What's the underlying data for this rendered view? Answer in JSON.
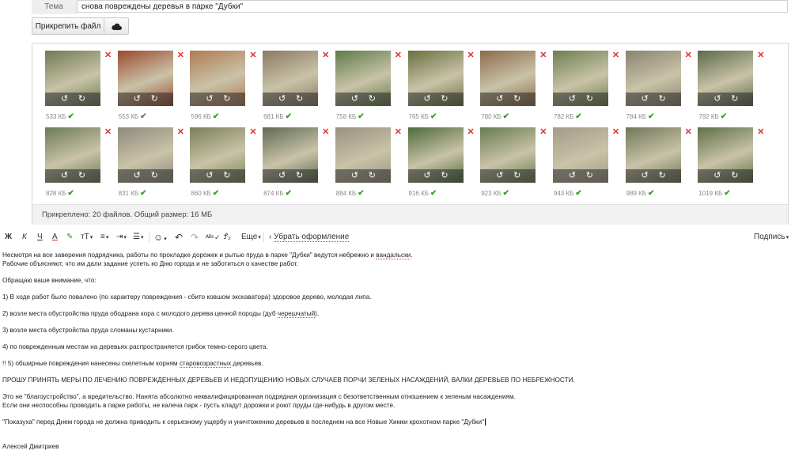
{
  "subject": {
    "label": "Тема",
    "value": "снова повреждены деревья в парке \"Дубки\""
  },
  "attach": {
    "button_label": "Прикрепить файл",
    "cloud_icon": "cloud-icon",
    "summary": "Прикреплено: 20 файлов. Общий размер: 16 МБ",
    "files": [
      {
        "size": "533 КБ",
        "tone": "#6f7a52"
      },
      {
        "size": "553 КБ",
        "tone": "#9a4a2e"
      },
      {
        "size": "596 КБ",
        "tone": "#b07a52"
      },
      {
        "size": "681 КБ",
        "tone": "#8a7a62"
      },
      {
        "size": "758 КБ",
        "tone": "#5f7a48"
      },
      {
        "size": "765 КБ",
        "tone": "#6a7040"
      },
      {
        "size": "780 КБ",
        "tone": "#8c6a4a"
      },
      {
        "size": "782 КБ",
        "tone": "#6d7f50"
      },
      {
        "size": "784 КБ",
        "tone": "#8a8270"
      },
      {
        "size": "792 КБ",
        "tone": "#5d6a4c"
      },
      {
        "size": "828 КБ",
        "tone": "#6c7a56"
      },
      {
        "size": "831 КБ",
        "tone": "#8f8a7c"
      },
      {
        "size": "860 КБ",
        "tone": "#7a8058"
      },
      {
        "size": "874 КБ",
        "tone": "#5f6a55"
      },
      {
        "size": "884 КБ",
        "tone": "#9a9080"
      },
      {
        "size": "916 КБ",
        "tone": "#4f6a3c"
      },
      {
        "size": "923 КБ",
        "tone": "#667a50"
      },
      {
        "size": "943 КБ",
        "tone": "#a49a88"
      },
      {
        "size": "989 КБ",
        "tone": "#6f7658"
      },
      {
        "size": "1019 КБ",
        "tone": "#5e7048"
      }
    ]
  },
  "toolbar": {
    "bold": "Ж",
    "italic": "К",
    "underline": "Ч",
    "text_color": "A",
    "highlight": "✎",
    "font_size": "тТ",
    "align": "≡",
    "indent": "⇥",
    "list": "☰",
    "emoji": "☺",
    "undo": "↶",
    "redo": "↷",
    "spellcheck": "ᴬᴮᶜ✓",
    "translit": "Ꝭ₂",
    "more": "Еще",
    "remove_format": "Убрать оформление",
    "signature": "Подпись"
  },
  "body": {
    "p1a": "Несмотря на все заверения подрядчика, работы по прокладке дорожек и рытью пруда в парке \"Дубки\" ведутся небрежно и ",
    "p1b": "вандальски",
    "p1c": ".",
    "p2": "Рабочие объясняют, что им дали задание успеть ко Дню города и не заботиться о качестве работ.",
    "p3": "Обращаю ваше внимание, что:",
    "p4": "1) В ходе работ было повалено (по характеру повреждения - сбито ковшом экскаватора) здоровое дерево, молодая липа.",
    "p5a": "2) возле места обустройства пруда ободрана кора с молодого дерева ценной породы (дуб ",
    "p5b": "черешчатый",
    "p5c": ").",
    "p6": "3) возле места обустройства пруда сломаны кустарники.",
    "p7": "4) по поврежденным местам на деревьях распространяется грибок темно-серого цвета.",
    "p8a": "!! 5) обширные повреждения нанесены скелетным корням ",
    "p8b": "старовозрастных",
    "p8c": " деревьев.",
    "p9": "ПРОШУ ПРИНЯТЬ МЕРЫ ПО ЛЕЧЕНИЮ ПОВРЕЖДЕННЫХ ДЕРЕВЬЕВ И НЕДОПУЩЕНИЮ НОВЫХ СЛУЧАЕВ ПОРЧИ ЗЕЛЕНЫХ НАСАЖДЕНИЙ, ВАЛКИ ДЕРЕВЬЕВ ПО НЕБРЕЖНОСТИ.",
    "p10": "Это не \"благоустройство\", а вредительство. Нанята абсолютно неквалифицированная подрядная организация с безответственным отношением к зеленым насаждениям.",
    "p11": "Если они неспособны проводить в парке работы, не калеча парк - пусть кладут дорожки и роют пруды где-нибудь в другом месте.",
    "p12": "\"Показуха\" перед Днем города не должна приводить к серьезному ущербу и уничтожению деревьев в последнем на все Новые Химки крохотном парке \"Дубки\"",
    "p13": "Алексей Дмитриев"
  }
}
